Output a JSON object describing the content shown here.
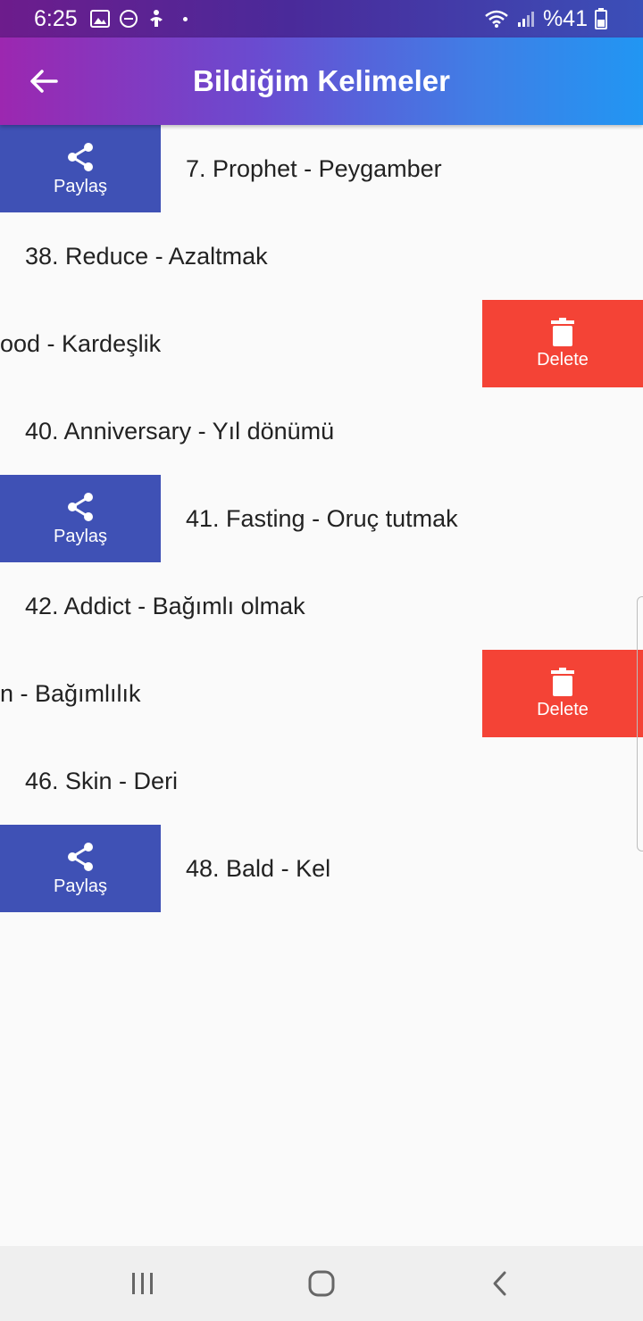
{
  "status": {
    "time": "6:25",
    "battery": "%41",
    "icons": [
      "image-icon",
      "dnd-icon",
      "accessibility-icon",
      "wifi-icon",
      "signal-icon",
      "battery-icon"
    ]
  },
  "app_bar": {
    "title": "Bildiğim Kelimeler",
    "back_icon": "arrow-left-icon"
  },
  "actions": {
    "share_label": "Paylaş",
    "delete_label": "Delete"
  },
  "words": [
    {
      "text": "7. Prophet - Peygamber",
      "state": "share-revealed"
    },
    {
      "text": "38. Reduce - Azaltmak",
      "state": "normal"
    },
    {
      "text": "ood - Kardeşlik",
      "state": "delete-revealed"
    },
    {
      "text": "40. Anniversary - Yıl dönümü",
      "state": "normal"
    },
    {
      "text": "41. Fasting - Oruç tutmak",
      "state": "share-revealed"
    },
    {
      "text": "42. Addict - Bağımlı olmak",
      "state": "normal"
    },
    {
      "text": "n - Bağımlılık",
      "state": "delete-revealed"
    },
    {
      "text": "46. Skin - Deri",
      "state": "normal"
    },
    {
      "text": "48. Bald - Kel",
      "state": "share-revealed"
    }
  ],
  "colors": {
    "share": "#3f51b5",
    "delete": "#f44336",
    "appbar_start": "#9c27b0",
    "appbar_end": "#2196f3"
  },
  "nav": [
    "recent-apps-icon",
    "home-icon",
    "back-icon"
  ]
}
